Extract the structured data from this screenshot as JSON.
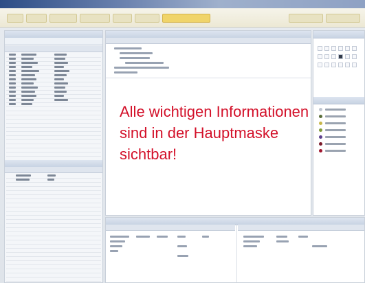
{
  "overlay": {
    "line1": "Alle wichtigen Informationen",
    "line2": "sind in der Hauptmaske",
    "line3": "sichtbar!"
  },
  "colors": {
    "overlay_text": "#d3112a",
    "titlebar": "#2d4d86",
    "toolbar_active": "#f0d469"
  },
  "icons": [
    "app-icon",
    "toolbar-icons",
    "legend-dots",
    "person-icons"
  ]
}
